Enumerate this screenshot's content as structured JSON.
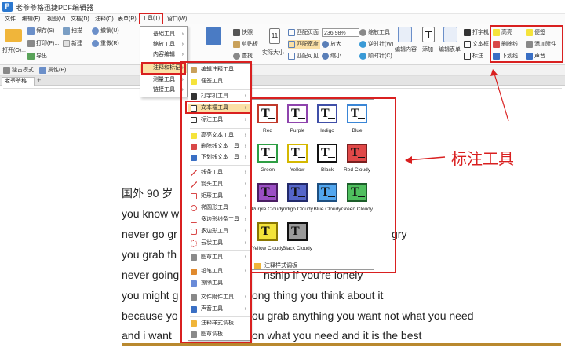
{
  "app": {
    "title": "老爷爷格迅捷PDF编辑器",
    "icon_letter": "P"
  },
  "menubar": {
    "items": [
      "文件",
      "编辑(E)",
      "视图(V)",
      "文档(D)",
      "注释(C)",
      "表单(R)",
      "工具(T)",
      "窗口(W)"
    ]
  },
  "ribbon": {
    "open_label": "打开(O)...",
    "file_buttons": [
      "保存(S)",
      "打印(P)...",
      "导出"
    ],
    "scan": "扫描",
    "new": "新建",
    "undo": "撤销(U)",
    "redo": "重做(R)",
    "snapshot": "快照",
    "clipboard": "剪贴板",
    "find": "查找",
    "actual_size": "实际大小",
    "fit_page": "匹配页面",
    "fit_width": "匹配宽度",
    "fit_visible": "匹配可见",
    "zoom_value": "236.98%",
    "zoom_in": "放大",
    "zoom_out": "缩小",
    "zoom_tool": "缩放工具",
    "rotate_cw": "逆时针(W)",
    "rotate_ccw": "顺时针(C)",
    "edit_content": "编辑内容",
    "add": "添加",
    "edit_form": "编辑表单",
    "typewriter": "打字机",
    "textbox": "文本框",
    "callout": "标注",
    "highlight": "高亮",
    "strikeout": "删除线",
    "underline": "下划线",
    "note": "便签",
    "attach_file": "添加附件",
    "sound": "声音"
  },
  "status": {
    "exclusive_mode": "独占模式",
    "properties": "属性(P)"
  },
  "tab": {
    "name": "老爷爷格",
    "add": "+"
  },
  "tools_menu": {
    "items": [
      "基础工具",
      "缩放工具",
      "内容编辑",
      "注释和标记",
      "测量工具",
      "链接工具"
    ]
  },
  "annot_menu": {
    "items": [
      "编辑注释工具",
      "便签工具",
      "打字机工具",
      "文本框工具",
      "标注工具",
      "高亮文本工具",
      "删除线文本工具",
      "下划线文本工具",
      "线条工具",
      "箭头工具",
      "矩形工具",
      "椭圆形工具",
      "多边形线条工具",
      "多边形工具",
      "云状工具",
      "图章工具",
      "铅笔工具",
      "擦除工具",
      "文件附件工具",
      "声音工具",
      "注释样式调板",
      "图章调板"
    ]
  },
  "gallery": {
    "styles": [
      "Red",
      "Purple",
      "Indigo",
      "Blue",
      "Green",
      "Yellow",
      "Black",
      "Red Cloudy",
      "Purple Cloudy",
      "Indigo Cloudy",
      "Blue Cloudy",
      "Green Cloudy",
      "Yellow Cloudy",
      "Black Cloudy"
    ],
    "footer": "注释样式调板",
    "glyph": "T"
  },
  "callout_text": "标注工具",
  "doc_lines": [
    "国外 90 岁",
    "you know w",
    "never go gr",
    "you grab th",
    "never going",
    "you might g",
    "because yo",
    "and i want"
  ],
  "doc_tails": [
    "",
    "",
    "gry",
    "",
    "nship if you're lonely",
    "ong thing you think about it",
    "ou grab anything you want not what you need",
    "on what you need and it is the best"
  ],
  "colors": {
    "accent_red": "#d92020",
    "highlight_bg": "#fbe0a5"
  }
}
